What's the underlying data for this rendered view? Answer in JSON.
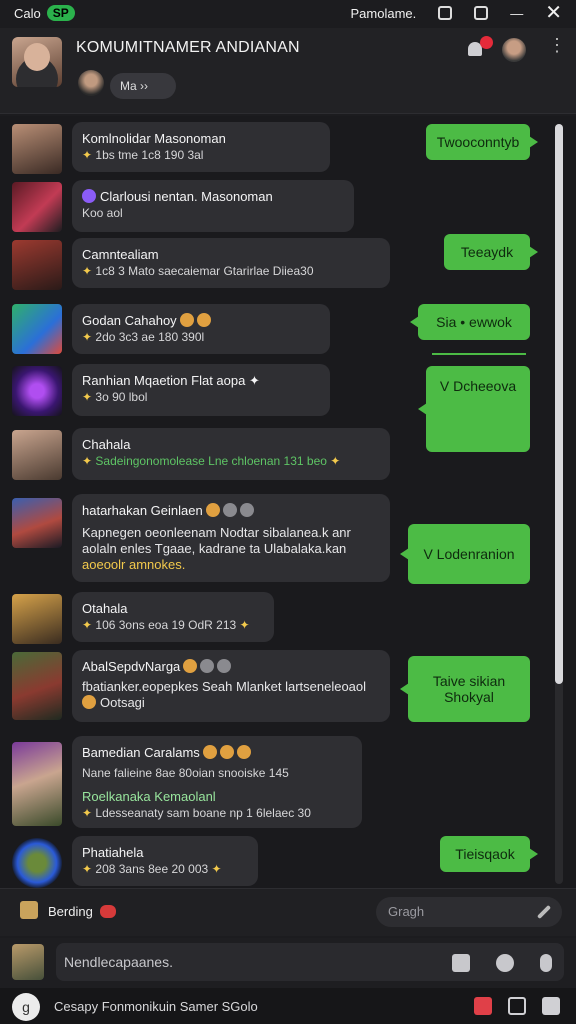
{
  "status_bar": {
    "left_label": "Calo",
    "logo_text": "SP",
    "right_label": "Pamolame."
  },
  "header": {
    "title": "KOMUMITNAMER ANDIANAN",
    "chip_label": "Ma   ››"
  },
  "messages": [
    {
      "name": "Komlnolidar Masonoman",
      "meta": "1bs tme 1c8 190 3al"
    },
    {
      "name": "Clarlousi nentan. Masonoman",
      "meta": "Koo aol"
    },
    {
      "name": "Camntealiam",
      "meta": "1c8 3   Mato saecaiemar Gtarirlae  Diiea30"
    },
    {
      "name": "Godan Cahahoy",
      "meta": "2do 3c3 ae 180 390l"
    },
    {
      "name": "Ranhian Mqaetion Flat aopa",
      "meta": "3o 90 lbol"
    },
    {
      "name": "Chahala",
      "meta": "Sadeingonomolease Lne chloenan 131 beo"
    },
    {
      "name": "hatarhakan Geinlaen",
      "body_line1": "Kapnegen oeonleenam Nodtar sibalanea.k anr",
      "body_line2": "aolaln enles Tgaae, kadrane ta Ulabalaka.kan",
      "body_line3": "aoeoolr amnokes."
    },
    {
      "name": "Otahala",
      "meta": "106 3ons eoa 19 OdR 213"
    },
    {
      "name": "AbalSepdvNarga",
      "body_line1": "fbatianker.eopepkes Seah  Mlanket lartseneleoaol",
      "body_line2": "Ootsagi"
    },
    {
      "name": "Bamedian Caralams",
      "meta": "Nane falieine 8ae 80oian  snooiske  145",
      "sub_name": "Roelkanaka Kemaolanl",
      "sub_meta": "Ldesseanaty sam boane np 1 6lelaec 30"
    },
    {
      "name": "Phatiahela",
      "meta": "208 3ans 8ee 20 003"
    }
  ],
  "outgoing": [
    {
      "text": "Twooconntyb"
    },
    {
      "text": "Teeaydk"
    },
    {
      "text": "Sia • ewwok"
    },
    {
      "text": "V Dcheeova"
    },
    {
      "text": "V Lodenranion"
    },
    {
      "text": "Taive sikian Shokyal"
    },
    {
      "text": "Tieisqaok"
    }
  ],
  "typing": {
    "label": "Berding",
    "search_placeholder": "Gragh"
  },
  "composer": {
    "placeholder": "Nendlecapaanes."
  },
  "bottom_bar": {
    "icon_letter": "g",
    "label": "Cesapy Fonmonikuin Samer SGolo"
  },
  "colors": {
    "accent_green": "#4cbb45",
    "badge_red": "#e52b3a",
    "bubble_bg": "#2f2f33",
    "app_bg": "#1a1a1d"
  }
}
